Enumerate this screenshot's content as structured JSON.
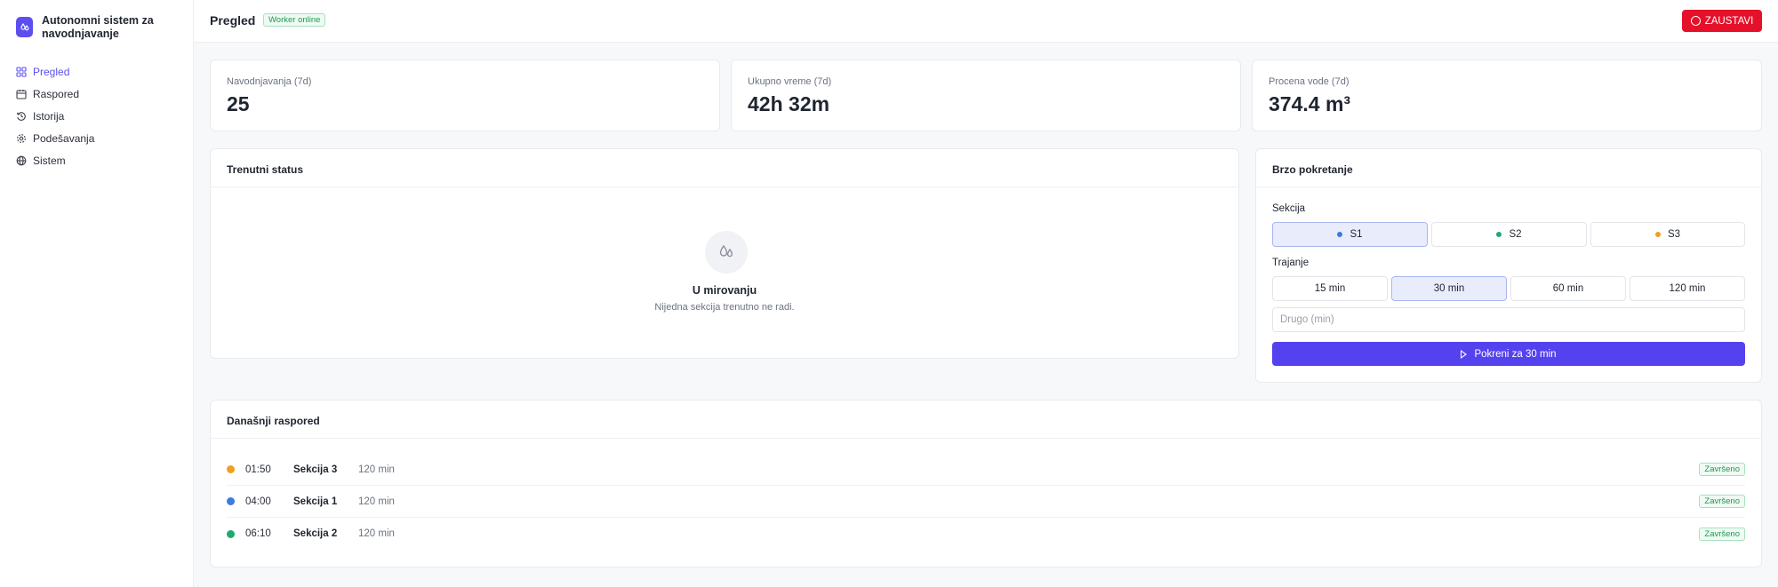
{
  "app": {
    "name": "Autonomni sistem za navodnjavanje"
  },
  "nav": {
    "items": [
      {
        "label": "Pregled",
        "icon": "grid-icon"
      },
      {
        "label": "Raspored",
        "icon": "calendar-icon"
      },
      {
        "label": "Istorija",
        "icon": "history-icon"
      },
      {
        "label": "Podešavanja",
        "icon": "gear-icon"
      },
      {
        "label": "Sistem",
        "icon": "globe-icon"
      }
    ]
  },
  "header": {
    "title": "Pregled",
    "worker_status": "Worker online",
    "stop_label": "ZAUSTAVI"
  },
  "stats": [
    {
      "label": "Navodnjavanja (7d)",
      "value": "25"
    },
    {
      "label": "Ukupno vreme (7d)",
      "value": "42h 32m"
    },
    {
      "label": "Procena vode (7d)",
      "value": "374.4 m³"
    }
  ],
  "status_card": {
    "title": "Trenutni status",
    "state_title": "U mirovanju",
    "state_sub": "Nijedna sekcija trenutno ne radi."
  },
  "quick_start": {
    "title": "Brzo pokretanje",
    "section_label": "Sekcija",
    "sections": [
      {
        "label": "S1",
        "color": "#3b7be0",
        "selected": true
      },
      {
        "label": "S2",
        "color": "#1fa971",
        "selected": false
      },
      {
        "label": "S3",
        "color": "#f0a020",
        "selected": false
      }
    ],
    "duration_label": "Trajanje",
    "durations": [
      {
        "label": "15 min",
        "selected": false
      },
      {
        "label": "30 min",
        "selected": true
      },
      {
        "label": "60 min",
        "selected": false
      },
      {
        "label": "120 min",
        "selected": false
      }
    ],
    "other_placeholder": "Drugo (min)",
    "start_label": "Pokreni za 30 min"
  },
  "schedule": {
    "title": "Današnji raspored",
    "rows": [
      {
        "time": "01:50",
        "section": "Sekcija 3",
        "duration": "120 min",
        "status": "Završeno",
        "color": "#f0a020"
      },
      {
        "time": "04:00",
        "section": "Sekcija 1",
        "duration": "120 min",
        "status": "Završeno",
        "color": "#3b7be0"
      },
      {
        "time": "06:10",
        "section": "Sekcija 2",
        "duration": "120 min",
        "status": "Završeno",
        "color": "#1fa971"
      }
    ]
  },
  "colors": {
    "accent": "#5b4ff0",
    "danger": "#e5112b",
    "success": "#1f9a55"
  }
}
